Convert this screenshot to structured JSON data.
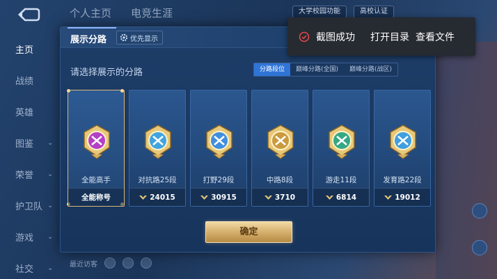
{
  "background": {
    "top_tabs": [
      "个人主页",
      "电竞生涯"
    ],
    "side_nav": [
      {
        "label": "主页",
        "active": true,
        "expandable": false
      },
      {
        "label": "战绩",
        "active": false,
        "expandable": false
      },
      {
        "label": "英雄",
        "active": false,
        "expandable": false
      },
      {
        "label": "图鉴",
        "active": false,
        "expandable": true
      },
      {
        "label": "荣誉",
        "active": false,
        "expandable": true
      },
      {
        "label": "护卫队",
        "active": false,
        "expandable": true
      },
      {
        "label": "游戏",
        "active": false,
        "expandable": true
      },
      {
        "label": "社交",
        "active": false,
        "expandable": true
      }
    ],
    "top_right_chips": [
      "大学校园功能",
      "高校认证"
    ],
    "bottom_label": "最近访客"
  },
  "modal": {
    "title": "展示分路",
    "priority_button": "优先显示",
    "prompt": "请选择展示的分路",
    "tabs": [
      {
        "label": "分路段位",
        "active": true
      },
      {
        "label": "巅峰分路(全国)",
        "active": false
      },
      {
        "label": "巅峰分路(战区)",
        "active": false
      }
    ],
    "cards": [
      {
        "name": "全能高手",
        "foot": "全能称号",
        "selected": true,
        "has_score_icon": false,
        "emblem": "all-round-emblem-icon",
        "color": "#b43fc8"
      },
      {
        "name": "对抗路25段",
        "foot": "24015",
        "selected": false,
        "has_score_icon": true,
        "emblem": "clash-lane-emblem-icon",
        "color": "#3fa4e0"
      },
      {
        "name": "打野29段",
        "foot": "30915",
        "selected": false,
        "has_score_icon": true,
        "emblem": "jungle-emblem-icon",
        "color": "#3f8fe0"
      },
      {
        "name": "中路8段",
        "foot": "3710",
        "selected": false,
        "has_score_icon": true,
        "emblem": "mid-lane-emblem-icon",
        "color": "#c99a3f"
      },
      {
        "name": "游走11段",
        "foot": "6814",
        "selected": false,
        "has_score_icon": true,
        "emblem": "roam-emblem-icon",
        "color": "#34a884"
      },
      {
        "name": "发育路22段",
        "foot": "19012",
        "selected": false,
        "has_score_icon": true,
        "emblem": "farm-lane-emblem-icon",
        "color": "#3f9fe0"
      }
    ],
    "confirm_button": "确定"
  },
  "toast": {
    "message": "截图成功",
    "open_folder": "打开目录",
    "view_file": "查看文件",
    "icon": "check-circle-icon",
    "icon_color": "#e04848"
  }
}
